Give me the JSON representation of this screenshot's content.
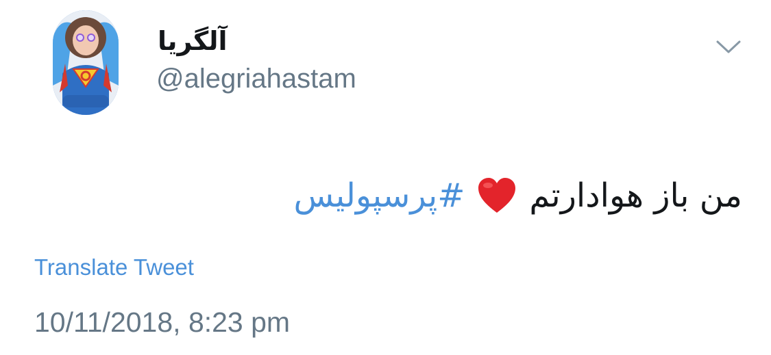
{
  "user": {
    "display_name": "آلگریا",
    "handle": "@alegriahastam",
    "avatar_icon": "avatar-superhero-icon"
  },
  "menu": {
    "icon": "chevron-down-icon"
  },
  "tweet": {
    "text": "من باز هوادارتم",
    "emoji": "❤️",
    "hashtag": "#پرسپولیس"
  },
  "translate_label": "Translate Tweet",
  "timestamp": "10/11/2018, 8:23 pm",
  "colors": {
    "link": "#4a90d9",
    "text": "#14171a",
    "secondary": "#657786"
  }
}
